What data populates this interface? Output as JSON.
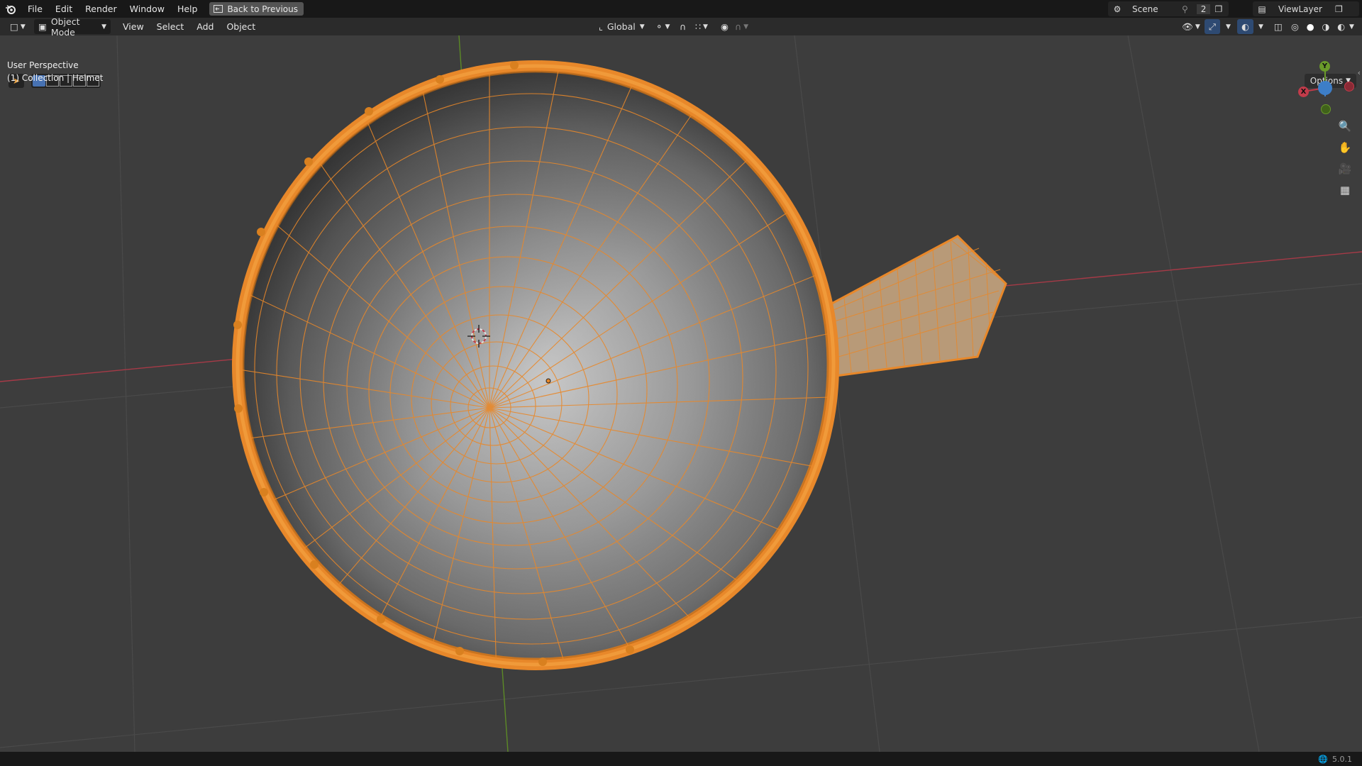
{
  "topbar": {
    "menus": [
      "File",
      "Edit",
      "Render",
      "Window",
      "Help"
    ],
    "back_button": "Back to Previous",
    "scene_name": "Scene",
    "scene_users": "2",
    "view_layer": "ViewLayer"
  },
  "header": {
    "mode": "Object Mode",
    "menus": [
      "View",
      "Select",
      "Add",
      "Object"
    ],
    "transform_orientation": "Global"
  },
  "viewport": {
    "perspective_label": "User Perspective",
    "collection_label": "(1) Collection | Helmet",
    "options_label": "Options",
    "gizmo": {
      "x": "X",
      "y": "Y"
    }
  },
  "status": {
    "version": "5.0.1"
  },
  "colors": {
    "selection_orange": "#e8882a",
    "x_axis": "#c23b4a",
    "y_axis": "#6a9a2a",
    "z_axis": "#3d7ec7"
  }
}
